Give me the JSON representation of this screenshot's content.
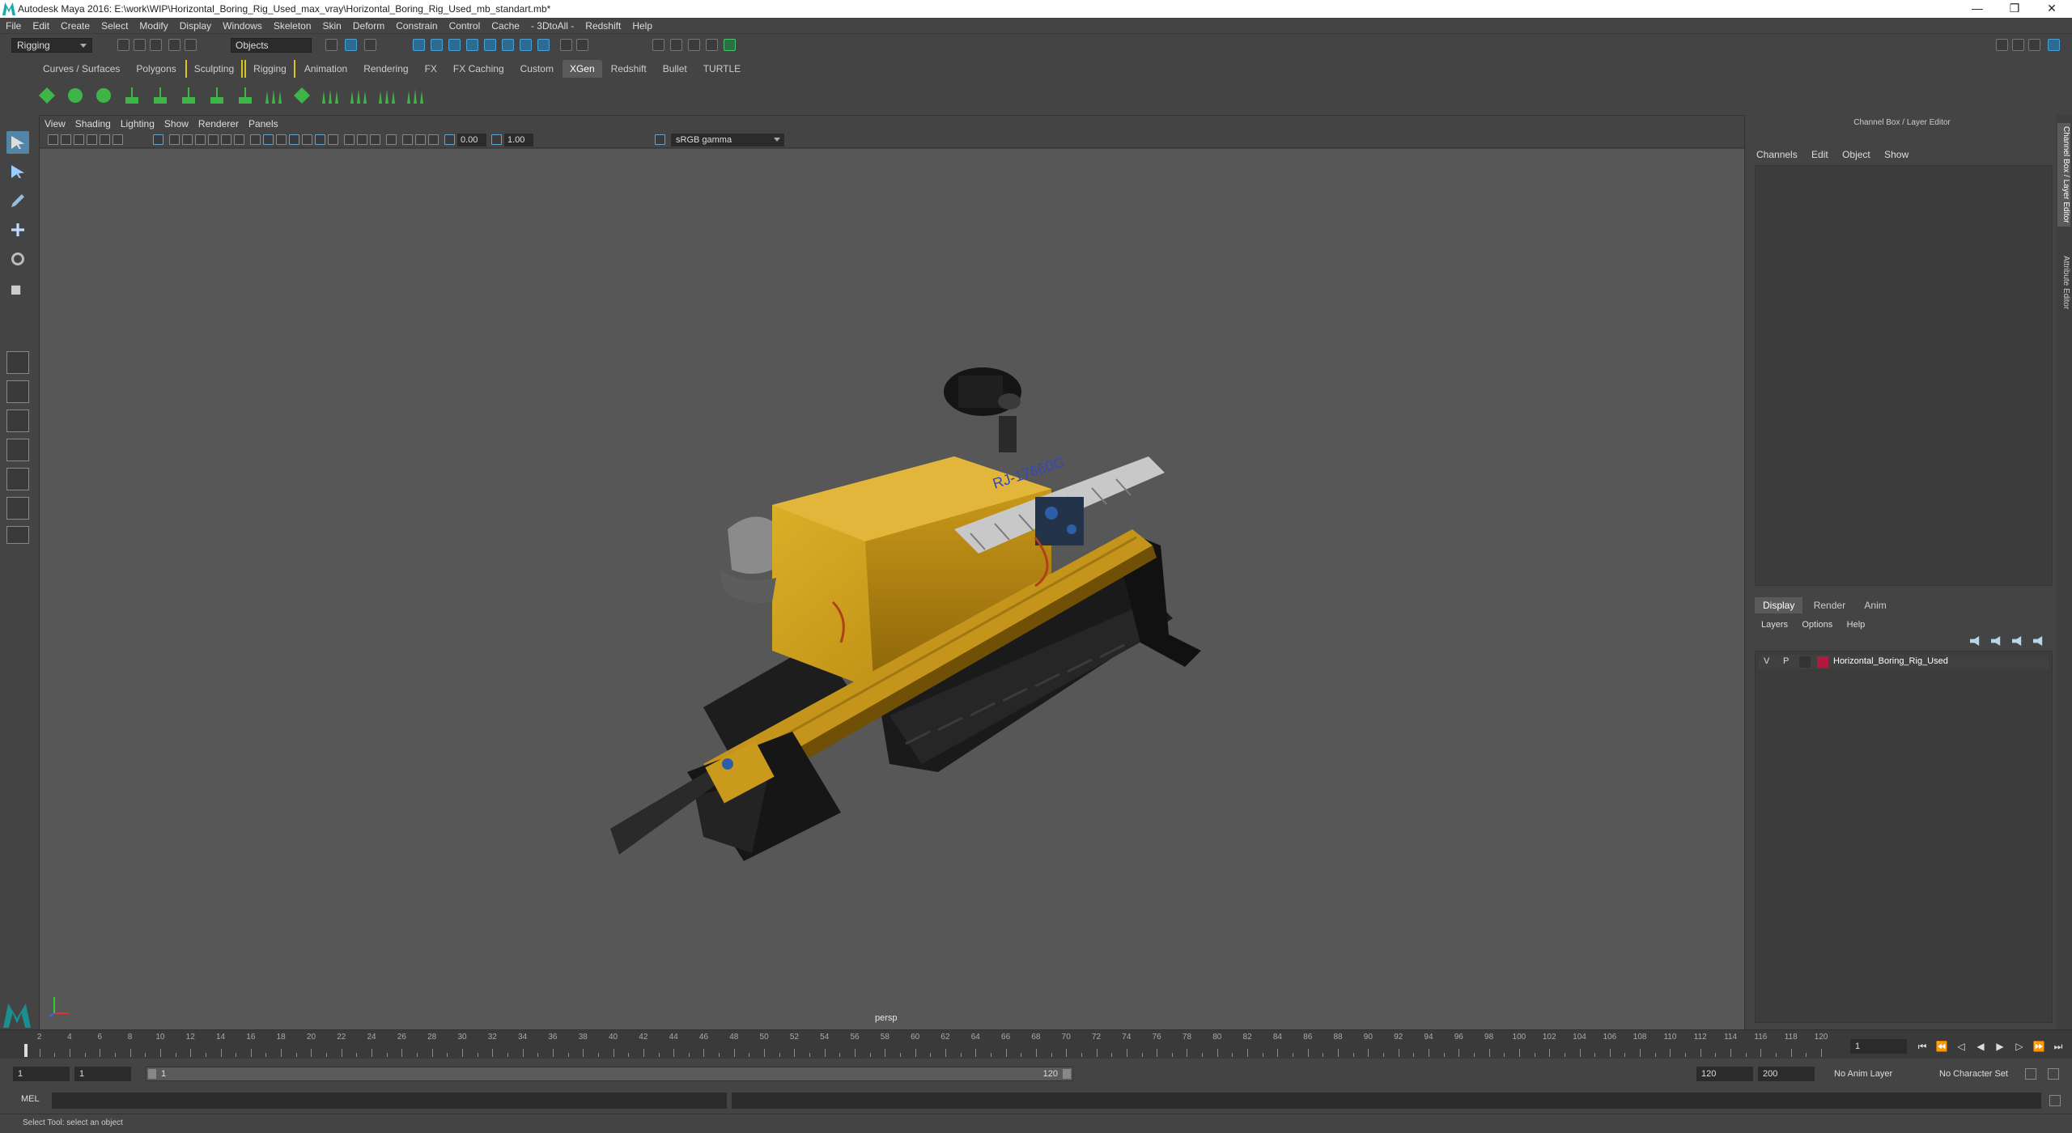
{
  "titlebar": {
    "title": "Autodesk Maya 2016: E:\\work\\WIP\\Horizontal_Boring_Rig_Used_max_vray\\Horizontal_Boring_Rig_Used_mb_standart.mb*",
    "minimize": "—",
    "restore": "❒",
    "close": "✕"
  },
  "menubar": [
    "File",
    "Edit",
    "Create",
    "Select",
    "Modify",
    "Display",
    "Windows",
    "Skeleton",
    "Skin",
    "Deform",
    "Constrain",
    "Control",
    "Cache",
    "- 3DtoAll -",
    "Redshift",
    "Help"
  ],
  "statusline": {
    "mode": "Rigging",
    "object_field": "Objects"
  },
  "shelf": {
    "tabs": [
      {
        "label": "Curves / Surfaces"
      },
      {
        "label": "Polygons"
      },
      {
        "label": "Sculpting",
        "bracket": true
      },
      {
        "label": "Rigging",
        "bracket": true
      },
      {
        "label": "Animation"
      },
      {
        "label": "Rendering"
      },
      {
        "label": "FX"
      },
      {
        "label": "FX Caching"
      },
      {
        "label": "Custom"
      },
      {
        "label": "XGen",
        "active": true
      },
      {
        "label": "Redshift"
      },
      {
        "label": "Bullet"
      },
      {
        "label": "TURTLE"
      }
    ]
  },
  "viewport": {
    "menu": [
      "View",
      "Shading",
      "Lighting",
      "Show",
      "Renderer",
      "Panels"
    ],
    "field_a": "0.00",
    "field_b": "1.00",
    "color_space": "sRGB gamma",
    "camera_label": "persp",
    "model_decal": "RJ-17660G",
    "colors": {
      "body": "#d4a51a",
      "dark": "#1c1c1c",
      "canvas": "#575757"
    }
  },
  "channel_box": {
    "title": "Channel Box / Layer Editor",
    "menu": [
      "Channels",
      "Edit",
      "Object",
      "Show"
    ]
  },
  "layer_editor": {
    "tabs": [
      {
        "label": "Display",
        "active": true
      },
      {
        "label": "Render"
      },
      {
        "label": "Anim"
      }
    ],
    "menu": [
      "Layers",
      "Options",
      "Help"
    ],
    "layer": {
      "v": "V",
      "p": "P",
      "name": "Horizontal_Boring_Rig_Used",
      "color": "#b01a3e"
    }
  },
  "side_tabs": [
    "Channel Box / Layer Editor",
    "Attribute Editor"
  ],
  "timeline": {
    "labels": [
      "2",
      "4",
      "6",
      "8",
      "10",
      "12",
      "14",
      "16",
      "18",
      "20",
      "22",
      "24",
      "26",
      "28",
      "30",
      "32",
      "34",
      "36",
      "38",
      "40",
      "42",
      "44",
      "46",
      "48",
      "50",
      "52",
      "54",
      "56",
      "58",
      "60",
      "62",
      "64",
      "66",
      "68",
      "70",
      "72",
      "74",
      "76",
      "78",
      "80",
      "82",
      "84",
      "86",
      "88",
      "90",
      "92",
      "94",
      "96",
      "98",
      "100",
      "102",
      "104",
      "106",
      "108",
      "110",
      "112",
      "114",
      "116",
      "118",
      "120"
    ],
    "start_marker": "1",
    "current_frame": "1"
  },
  "range": {
    "start": "1",
    "playback_start": "1",
    "slider_start": "1",
    "slider_end": "120",
    "playback_end": "120",
    "end": "200",
    "anim_layer": "No Anim Layer",
    "character_set": "No Character Set"
  },
  "command": {
    "lang": "MEL"
  },
  "help_line": "Select Tool: select an object"
}
